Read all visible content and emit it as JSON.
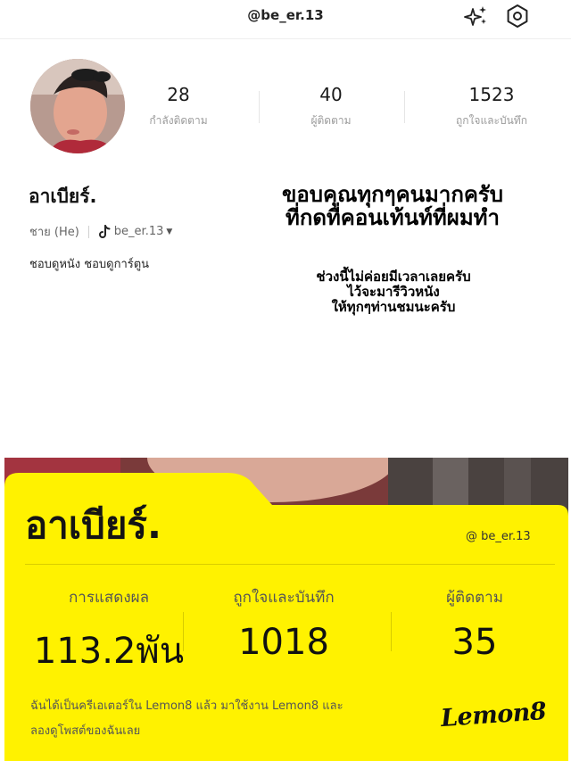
{
  "header": {
    "handle": "@be_er.13",
    "icons": [
      "sparkle-icon",
      "settings-icon"
    ]
  },
  "profile": {
    "stats": [
      {
        "value": "28",
        "label": "กำลังติดตาม"
      },
      {
        "value": "40",
        "label": "ผู้ติดตาม"
      },
      {
        "value": "1523",
        "label": "ถูกใจและบันทึก"
      }
    ],
    "name": "อาเบียร์.",
    "gender": "ชาย (He)",
    "tiktok_handle": "be_er.13",
    "bio": "ชอบดูหนัง ชอบดูการ์ตูน"
  },
  "overlay_text": {
    "thanks_line1": "ขอบคุณทุกๆคนมากครับ",
    "thanks_line2": "ที่กดที่คอนเท้นท์ที่ผมทำ",
    "note_line1": "ช่วงนี้ไม่ค่อยมีเวลาเลยครับ",
    "note_line2": "ไว้จะมารีวิวหนัง",
    "note_line3": "ให้ทุกๆท่านชมนะครับ"
  },
  "card": {
    "name": "อาเบียร์.",
    "handle": "@ be_er.13",
    "stats": [
      {
        "label": "การแสดงผล",
        "value": "113.2พัน"
      },
      {
        "label": "ถูกใจและบันทึก",
        "value": "1018"
      },
      {
        "label": "ผู้ติดตาม",
        "value": "35"
      }
    ],
    "promo_line1": "ฉันได้เป็นครีเอเตอร์ใน Lemon8 แล้ว มาใช้งาน Lemon8 และ",
    "promo_line2": "ลองดูโพสต์ของฉันเลย",
    "logo": "Lemon8",
    "accent_color": "#fff200"
  }
}
